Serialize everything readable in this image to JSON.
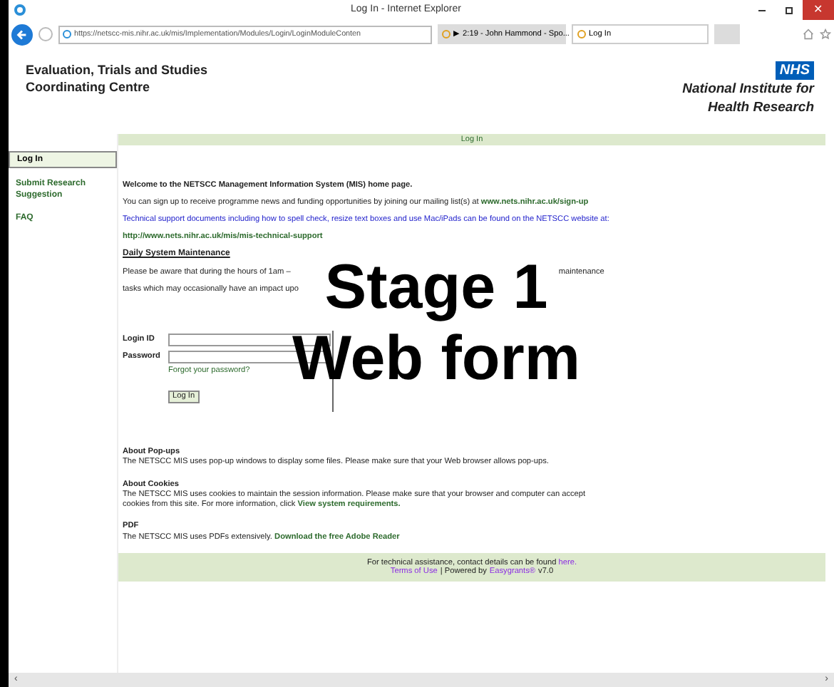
{
  "browser": {
    "title": "Log In - Internet Explorer",
    "address": "https://netscc-mis.nihr.ac.uk/mis/Implementation/Modules/Login/LoginModuleConten",
    "tabs": [
      {
        "label": "▶ 2:19 - John Hammond - Spo...",
        "selected": false
      },
      {
        "label": "Log In",
        "selected": true
      }
    ],
    "close_glyph": "✕",
    "scroll_left": "‹",
    "scroll_right": "›"
  },
  "header": {
    "title_lines": [
      "Evaluation, Trials and Studies",
      "Coordinating Centre"
    ],
    "logo_badge": "NHS",
    "logo_lines": [
      "National Institute for",
      "Health Research"
    ]
  },
  "sidebar": {
    "items": [
      {
        "label": "Log In",
        "selected": true
      },
      {
        "label": "Submit Research Suggestion",
        "selected": false
      },
      {
        "label": "FAQ",
        "selected": false
      }
    ]
  },
  "main": {
    "bar_title": "Log In",
    "welcome": "Welcome to the NETSCC Management Information System (MIS) home page.",
    "signup": {
      "text": "You can sign up to receive programme news and funding opportunities by joining our mailing list(s) at",
      "link": "www.nets.nihr.ac.uk/sign-up"
    },
    "tech_support": "Technical support documents including how to spell check, resize text boxes and use Mac/iPads can be found on the NETSCC website at:",
    "tech_link": "http://www.nets.nihr.ac.uk/mis/mis-technical-support",
    "maintenance_heading": "Daily System Maintenance",
    "maintenance_fragments": [
      "Please be aware that during the hours of 1am –",
      "maintenance",
      "tasks which may occasionally have an impact upo"
    ],
    "form": {
      "login_label": "Login ID",
      "password_label": "Password",
      "forgot": "Forgot your password?",
      "button": "Log In"
    },
    "sections": [
      {
        "heading": "About Pop-ups",
        "text": "The NETSCC MIS uses pop-up windows to display some files. Please make sure that your Web browser allows pop-ups."
      },
      {
        "heading": "About Cookies",
        "text": "The NETSCC MIS uses cookies to maintain the session information. Please make sure that your browser and computer can accept cookies from this site. For more information, click",
        "link": "View system requirements."
      },
      {
        "heading": "PDF",
        "text": "The NETSCC MIS uses PDFs extensively.",
        "link": "Download the free Adobe Reader"
      }
    ],
    "footer": {
      "text": "For technical assistance, contact details can be found",
      "here": "here.",
      "terms": "Terms of Use",
      "powered": "| Powered by",
      "brand": "Easygrants®",
      "version": "v7.0"
    }
  },
  "overlay": [
    "Stage 1",
    "Web form"
  ]
}
